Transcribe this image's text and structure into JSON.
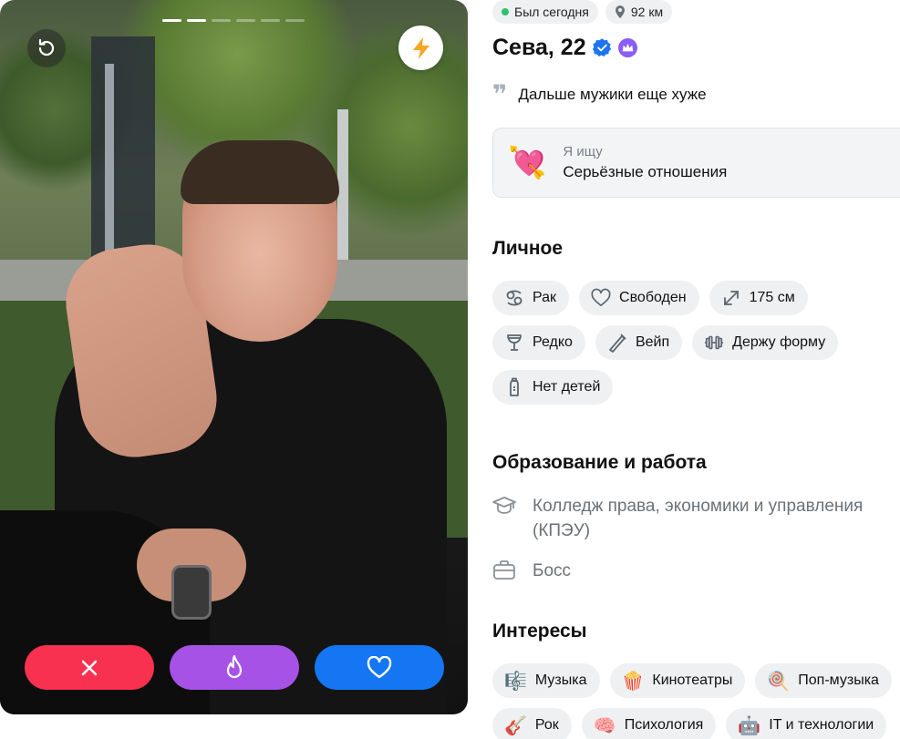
{
  "photo": {
    "progress_total": 6,
    "progress_active": 2
  },
  "status": {
    "online": "Был сегодня",
    "distance": "92 км"
  },
  "profile": {
    "name_age": "Сева, 22",
    "quote": "Дальше мужики еще хуже"
  },
  "looking_for": {
    "label": "Я ищу",
    "value": "Серьёзные отношения",
    "emoji": "💘"
  },
  "personal": {
    "title": "Личное",
    "items": [
      {
        "icon": "zodiac-cancer-icon",
        "label": "Рак"
      },
      {
        "icon": "heart-outline-icon",
        "label": "Свободен"
      },
      {
        "icon": "height-arrows-icon",
        "label": "175 см"
      },
      {
        "icon": "wine-glass-icon",
        "label": "Редко"
      },
      {
        "icon": "vape-icon",
        "label": "Вейп"
      },
      {
        "icon": "dumbbell-icon",
        "label": "Держу форму"
      },
      {
        "icon": "baby-bottle-icon",
        "label": "Нет детей"
      }
    ]
  },
  "education": {
    "title": "Образование и работа",
    "school": "Колледж права, экономики и управления (КПЭУ)",
    "job": "Босс"
  },
  "interests": {
    "title": "Интересы",
    "items": [
      {
        "emoji": "🎼",
        "label": "Музыка"
      },
      {
        "emoji": "🍿",
        "label": "Кинотеатры"
      },
      {
        "emoji": "🍭",
        "label": "Поп-музыка"
      },
      {
        "emoji": "🎸",
        "label": "Рок"
      },
      {
        "emoji": "🧠",
        "label": "Психология"
      },
      {
        "emoji": "🤖",
        "label": "IT и технологии"
      }
    ]
  },
  "colors": {
    "dislike": "#f7314f",
    "superlike": "#a652e6",
    "like": "#1476f2",
    "boost": "#f5a623",
    "online": "#2cc46b"
  }
}
